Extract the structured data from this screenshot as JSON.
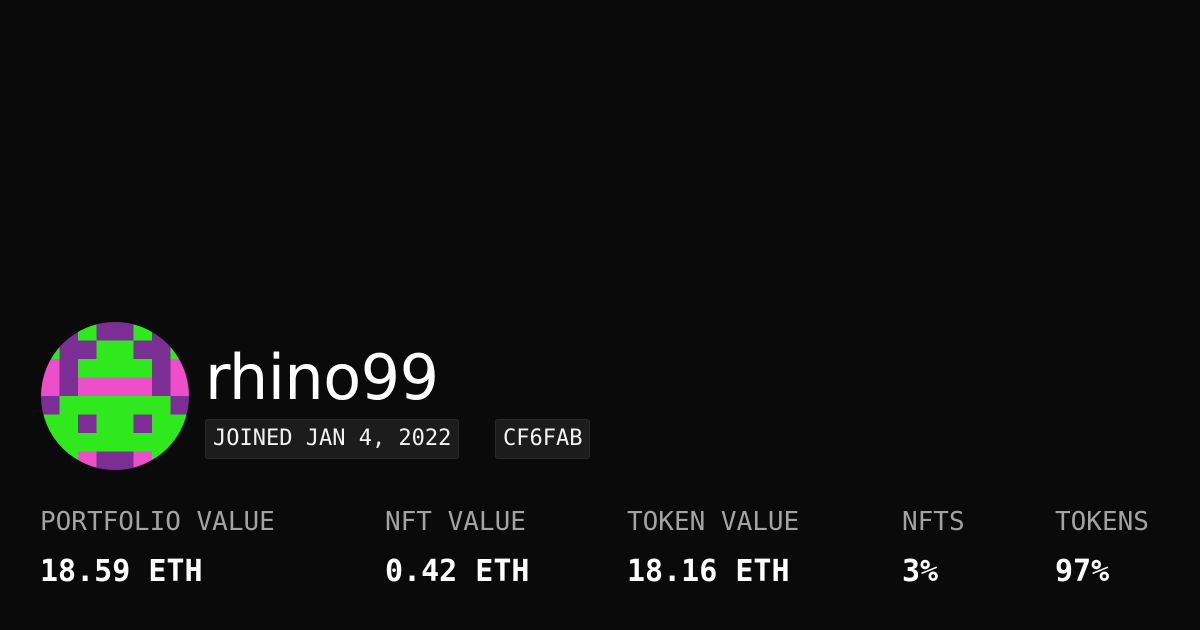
{
  "profile": {
    "avatar_icon": "pixel-avatar-icon",
    "avatar_colors": {
      "green": "#2fe81e",
      "purple": "#7b2f94",
      "pink": "#ec4fc9"
    },
    "username": "rhino99",
    "joined_text": "JOINED JAN 4, 2022",
    "id_tag": "CF6FAB"
  },
  "stats": [
    {
      "label": "PORTFOLIO VALUE",
      "value": "18.59 ETH"
    },
    {
      "label": "NFT VALUE",
      "value": "0.42 ETH"
    },
    {
      "label": "TOKEN VALUE",
      "value": "18.16 ETH"
    },
    {
      "label": "NFTS",
      "value": "3%"
    },
    {
      "label": "TOKENS",
      "value": "97%"
    }
  ],
  "colors": {
    "background": "#0a0a0a",
    "text_primary": "#ffffff",
    "text_secondary": "#a3a3a3",
    "tag_background": "#1c1c1c"
  }
}
